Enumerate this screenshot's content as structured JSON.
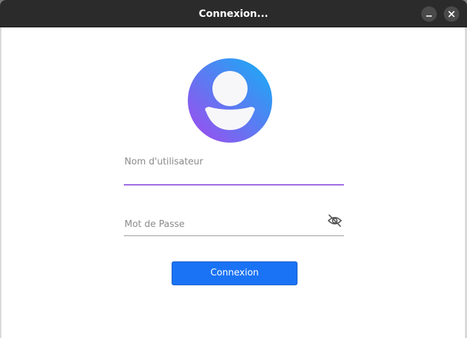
{
  "window": {
    "title": "Connexion..."
  },
  "form": {
    "username_label": "Nom d'utilisateur",
    "password_label": "Mot de Passe",
    "submit_label": "Connexion"
  },
  "icons": {
    "avatar": "user-avatar-icon",
    "password_toggle": "eye-slash-icon",
    "minimize": "minimize-icon",
    "close": "close-icon"
  },
  "colors": {
    "titlebar": "#2b2b2b",
    "avatar_gradient_start": "#1aa6f5",
    "avatar_gradient_end": "#9b4cf0",
    "focus_underline": "#9b6be0",
    "button": "#1a73f5"
  }
}
